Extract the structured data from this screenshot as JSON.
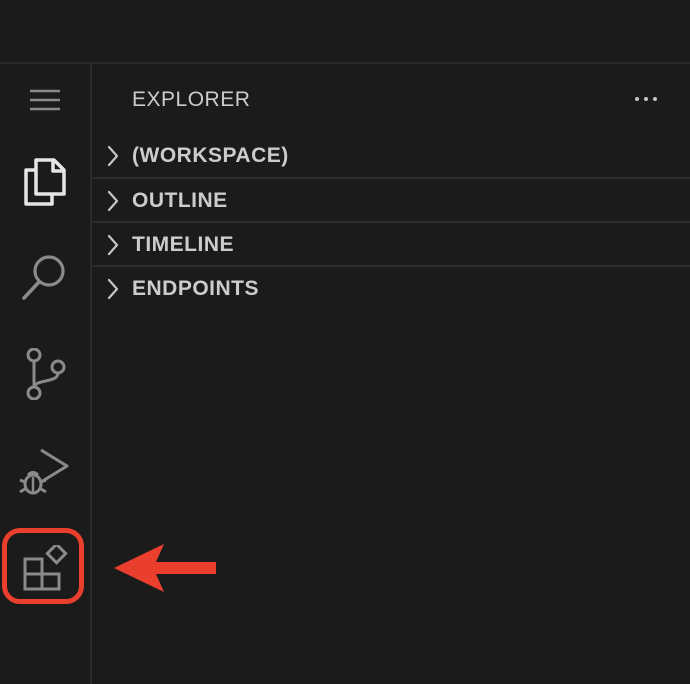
{
  "sidebar": {
    "title": "EXPLORER",
    "sections": [
      {
        "label": "(WORKSPACE)"
      },
      {
        "label": "OUTLINE"
      },
      {
        "label": "TIMELINE"
      },
      {
        "label": "ENDPOINTS"
      }
    ]
  },
  "activity_bar": {
    "items": [
      {
        "icon": "menu-icon"
      },
      {
        "icon": "explorer-icon"
      },
      {
        "icon": "search-icon"
      },
      {
        "icon": "source-control-icon"
      },
      {
        "icon": "run-and-debug-icon"
      },
      {
        "icon": "extensions-icon"
      }
    ]
  },
  "colors": {
    "background": "#1b1b1c",
    "foreground": "#cccccc",
    "icon": "#c5c5c5",
    "icon_inactive": "#8a8a8a",
    "annotation": "#ea3f2d"
  }
}
